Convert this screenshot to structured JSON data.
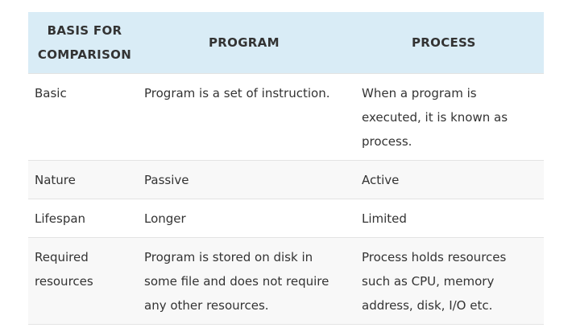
{
  "table": {
    "headers": [
      "BASIS FOR\nCOMPARISON",
      "PROGRAM",
      "PROCESS"
    ],
    "header_bg": "#d9ecf6",
    "rows": [
      [
        "Basic",
        "Program is a set of instruction.",
        "When a program is executed, it is known as process."
      ],
      [
        "Nature",
        "Passive",
        "Active"
      ],
      [
        "Lifespan",
        "Longer",
        "Limited"
      ],
      [
        "Required resources",
        "Program is stored on disk in some file and does not require any other resources.",
        "Process holds resources such as CPU, memory address, disk, I/O etc."
      ]
    ]
  }
}
